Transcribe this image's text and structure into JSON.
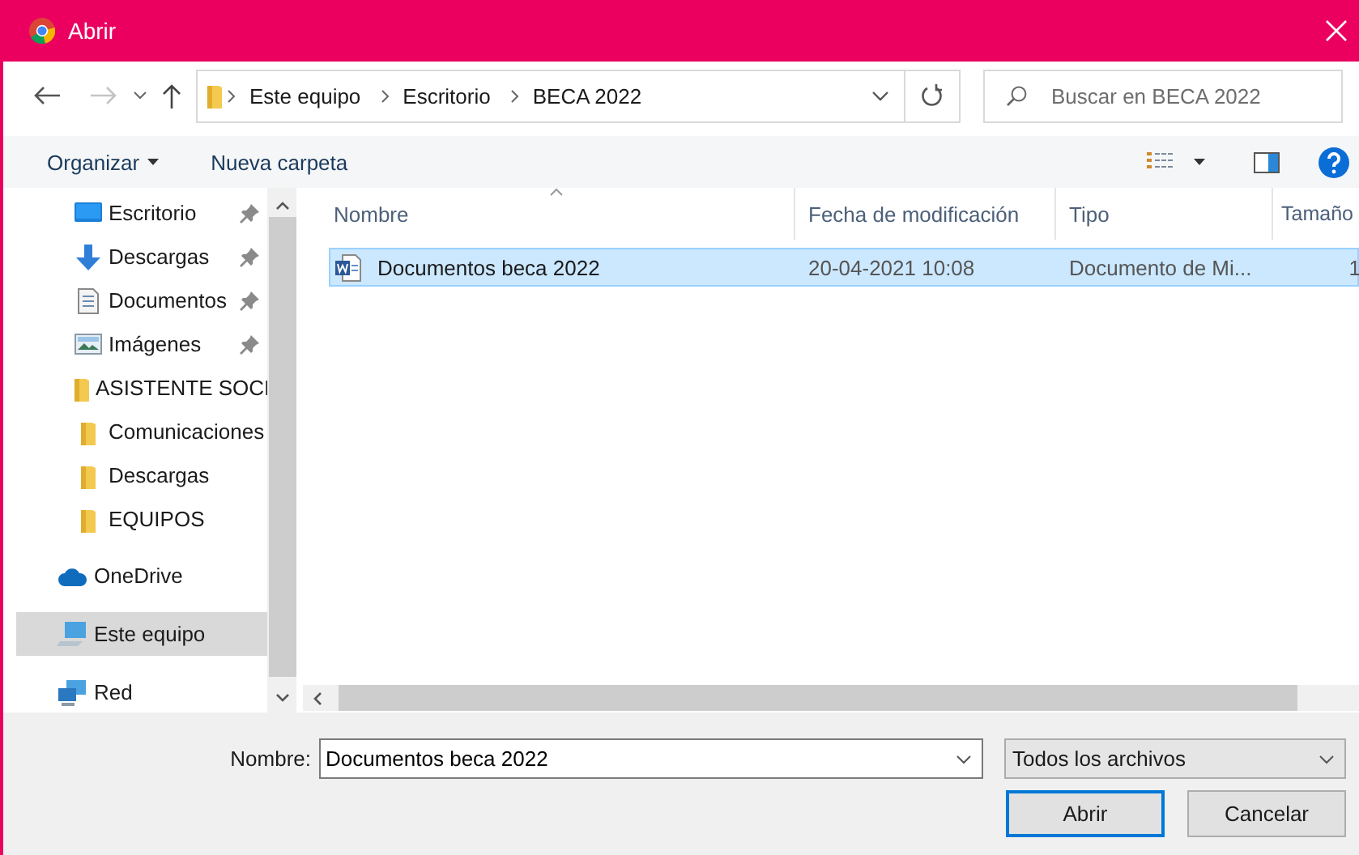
{
  "window": {
    "title": "Abrir"
  },
  "navigation": {
    "back": {
      "disabled": false
    },
    "forward": {
      "disabled": true
    },
    "path": [
      "Este equipo",
      "Escritorio",
      "BECA 2022"
    ]
  },
  "search": {
    "placeholder": "Buscar en BECA 2022"
  },
  "toolbar": {
    "buttons": [
      {
        "label": "Organizar",
        "kind": "menu"
      },
      {
        "label": "Nueva carpeta",
        "kind": "plain"
      }
    ]
  },
  "sidebar": {
    "quick_access": [
      {
        "label": "Escritorio",
        "kind": "desktop",
        "pinned": true,
        "selected": false
      },
      {
        "label": "Descargas",
        "kind": "download",
        "pinned": true,
        "selected": false
      },
      {
        "label": "Documentos",
        "kind": "document",
        "pinned": true,
        "selected": false
      },
      {
        "label": "Imágenes",
        "kind": "pictures",
        "pinned": true,
        "selected": false
      },
      {
        "label": "ASISTENTE SOCI",
        "kind": "folder",
        "pinned": false,
        "selected": false
      },
      {
        "label": "Comunicaciones",
        "kind": "folder",
        "pinned": false,
        "selected": false
      },
      {
        "label": "Descargas",
        "kind": "folder",
        "pinned": false,
        "selected": false
      },
      {
        "label": "EQUIPOS",
        "kind": "folder",
        "pinned": false,
        "selected": false
      }
    ],
    "locations": [
      {
        "label": "OneDrive",
        "kind": "cloud",
        "selected": false
      },
      {
        "label": "Este equipo",
        "kind": "computer",
        "selected": true
      },
      {
        "label": "Red",
        "kind": "network",
        "selected": false
      }
    ]
  },
  "table": {
    "columns": [
      {
        "label": "Nombre",
        "sorted": true
      },
      {
        "label": "Fecha de modificación",
        "sorted": false
      },
      {
        "label": "Tipo",
        "sorted": false
      },
      {
        "label": "Tamaño",
        "sorted": false
      }
    ],
    "rows": [
      {
        "name": "Documentos beca 2022",
        "modified": "20-04-2021 10:08",
        "type": "Documento de Mi...",
        "size": "1",
        "selected": true
      }
    ]
  },
  "footer": {
    "name_label": "Nombre:",
    "name_value": "Documentos beca 2022",
    "filter": "Todos los archivos",
    "buttons": [
      {
        "label": "Abrir",
        "default": true
      },
      {
        "label": "Cancelar",
        "default": false
      }
    ]
  }
}
